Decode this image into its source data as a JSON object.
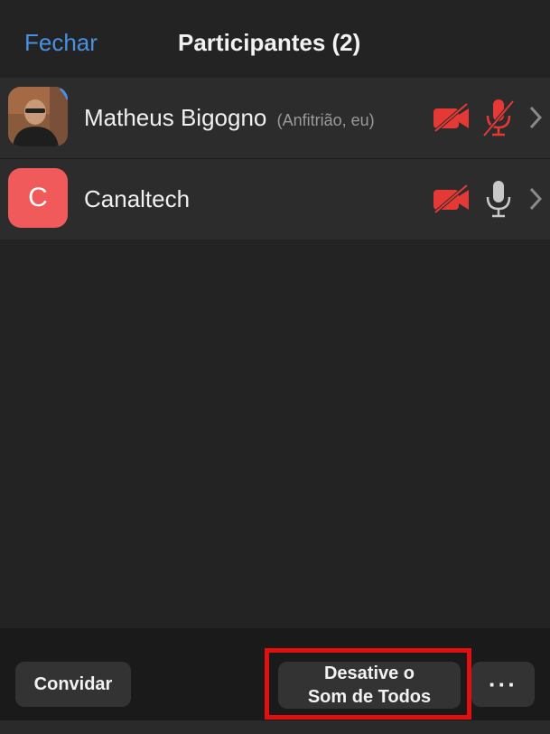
{
  "header": {
    "close_label": "Fechar",
    "title": "Participantes (2)"
  },
  "participants": [
    {
      "name": "Matheus Bigogno",
      "role": "(Anfitrião, eu)",
      "avatar": "photo",
      "video_icon": "video-off-icon",
      "mic_icon": "mic-muted-icon",
      "mic_state": "muted"
    },
    {
      "name": "Canaltech",
      "role": "",
      "avatar_letter": "C",
      "avatar_color": "#f05a5a",
      "video_icon": "video-off-icon",
      "mic_icon": "mic-icon",
      "mic_state": "on"
    }
  ],
  "toolbar": {
    "invite_label": "Convidar",
    "mute_all_line1": "Desative o",
    "mute_all_line2": "Som de Todos",
    "more_label": "···"
  },
  "colors": {
    "accent": "#4a90e2",
    "muted_red": "#e53935",
    "highlight": "#e01010"
  }
}
